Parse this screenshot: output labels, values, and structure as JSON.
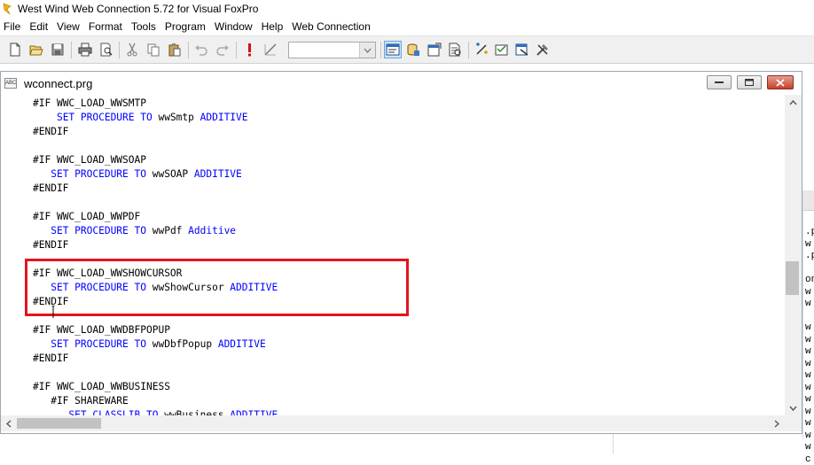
{
  "app": {
    "title": "West Wind Web Connection 5.72 for Visual FoxPro"
  },
  "menu": {
    "items": [
      "File",
      "Edit",
      "View",
      "Format",
      "Tools",
      "Program",
      "Window",
      "Help",
      "Web Connection"
    ]
  },
  "toolbar": {
    "combo_value": "",
    "icons": [
      "new-icon",
      "open-icon",
      "save-icon",
      "print-icon",
      "print-preview-icon",
      "cut-icon",
      "copy-icon",
      "paste-icon",
      "undo-icon",
      "redo-icon",
      "run-icon",
      "modify-form-icon",
      "command-window-icon",
      "data-session-icon",
      "properties-icon",
      "code-window-icon",
      "form-designer-icon",
      "class-browser-icon",
      "wizard-icon",
      "builder-icon"
    ]
  },
  "editor": {
    "file_title": "wconnect.prg",
    "file_icon_text": "ABC",
    "code_lines": [
      {
        "parts": [
          {
            "t": "#IF",
            "kw": false
          },
          {
            "t": " WWC_LOAD_WWSMTP",
            "kw": false
          }
        ]
      },
      {
        "parts": [
          {
            "t": "    ",
            "kw": false
          },
          {
            "t": "SET PROCEDURE TO",
            "kw": true
          },
          {
            "t": " wwSmtp ",
            "kw": false
          },
          {
            "t": "ADDITIVE",
            "kw": true
          }
        ]
      },
      {
        "parts": [
          {
            "t": "#ENDIF",
            "kw": false
          }
        ]
      },
      {
        "parts": [
          {
            "t": "",
            "kw": false
          }
        ]
      },
      {
        "parts": [
          {
            "t": "#IF",
            "kw": false
          },
          {
            "t": " WWC_LOAD_WWSOAP",
            "kw": false
          }
        ]
      },
      {
        "parts": [
          {
            "t": "   ",
            "kw": false
          },
          {
            "t": "SET PROCEDURE TO",
            "kw": true
          },
          {
            "t": " wwSOAP ",
            "kw": false
          },
          {
            "t": "ADDITIVE",
            "kw": true
          }
        ]
      },
      {
        "parts": [
          {
            "t": "#ENDIF",
            "kw": false
          }
        ]
      },
      {
        "parts": [
          {
            "t": "",
            "kw": false
          }
        ]
      },
      {
        "parts": [
          {
            "t": "#IF",
            "kw": false
          },
          {
            "t": " WWC_LOAD_WWPDF",
            "kw": false
          }
        ]
      },
      {
        "parts": [
          {
            "t": "   ",
            "kw": false
          },
          {
            "t": "SET PROCEDURE TO",
            "kw": true
          },
          {
            "t": " wwPdf ",
            "kw": false
          },
          {
            "t": "Additive",
            "kw": true
          }
        ]
      },
      {
        "parts": [
          {
            "t": "#ENDIF",
            "kw": false
          }
        ]
      },
      {
        "parts": [
          {
            "t": "",
            "kw": false
          }
        ]
      },
      {
        "parts": [
          {
            "t": "#IF",
            "kw": false
          },
          {
            "t": " WWC_LOAD_WWSHOWCURSOR",
            "kw": false
          }
        ]
      },
      {
        "parts": [
          {
            "t": "   ",
            "kw": false
          },
          {
            "t": "SET PROCEDURE TO",
            "kw": true
          },
          {
            "t": " wwShowCursor ",
            "kw": false
          },
          {
            "t": "ADDITIVE",
            "kw": true
          }
        ]
      },
      {
        "parts": [
          {
            "t": "#ENDIF",
            "kw": false
          }
        ]
      },
      {
        "parts": [
          {
            "t": "",
            "kw": false
          }
        ]
      },
      {
        "parts": [
          {
            "t": "#IF",
            "kw": false
          },
          {
            "t": " WWC_LOAD_WWDBFPOPUP",
            "kw": false
          }
        ]
      },
      {
        "parts": [
          {
            "t": "   ",
            "kw": false
          },
          {
            "t": "SET PROCEDURE TO",
            "kw": true
          },
          {
            "t": " wwDbfPopup ",
            "kw": false
          },
          {
            "t": "ADDITIVE",
            "kw": true
          }
        ]
      },
      {
        "parts": [
          {
            "t": "#ENDIF",
            "kw": false
          }
        ]
      },
      {
        "parts": [
          {
            "t": "",
            "kw": false
          }
        ]
      },
      {
        "parts": [
          {
            "t": "#IF",
            "kw": false
          },
          {
            "t": " WWC_LOAD_WWBUSINESS",
            "kw": false
          }
        ]
      },
      {
        "parts": [
          {
            "t": "   #IF",
            "kw": false
          },
          {
            "t": " SHAREWARE",
            "kw": false
          }
        ]
      },
      {
        "parts": [
          {
            "t": "      ",
            "kw": false
          },
          {
            "t": "SET CLASSLIB TO",
            "kw": true
          },
          {
            "t": " wwBusiness ",
            "kw": false
          },
          {
            "t": "ADDITIVE",
            "kw": true
          }
        ]
      }
    ]
  },
  "background_window": {
    "fragments": [
      ".p",
      "w",
      ".p",
      "",
      "on",
      "w",
      "w",
      "",
      "w",
      "w",
      "w",
      "w",
      "w",
      "w",
      "w",
      "w",
      "w",
      "w",
      "w",
      "c"
    ]
  },
  "colors": {
    "keyword": "#0000ff",
    "highlight_border": "#e3141e",
    "close_button": "#c4402c"
  }
}
